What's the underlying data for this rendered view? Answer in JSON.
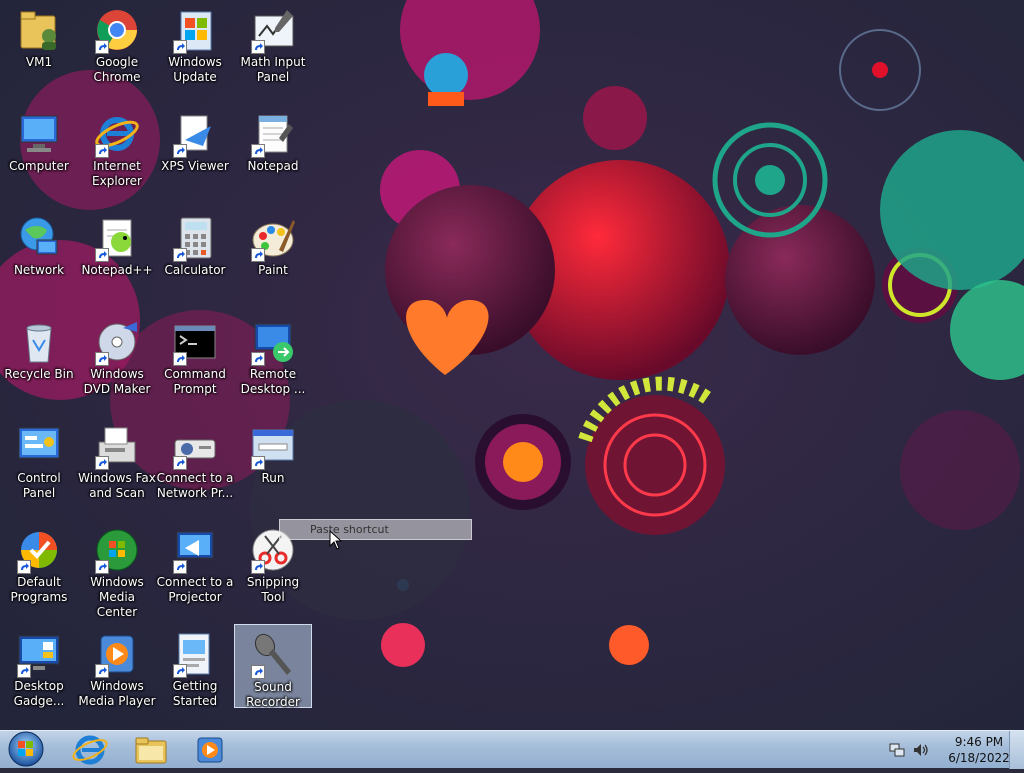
{
  "desktop": {
    "icons": [
      {
        "id": "vm1",
        "label": "VM1",
        "shortcut": false,
        "glyph": "folder-user-icon"
      },
      {
        "id": "chrome",
        "label": "Google\nChrome",
        "shortcut": true,
        "glyph": "chrome-icon"
      },
      {
        "id": "winupdate",
        "label": "Windows\nUpdate",
        "shortcut": true,
        "glyph": "windows-update-icon"
      },
      {
        "id": "mathinput",
        "label": "Math Input\nPanel",
        "shortcut": true,
        "glyph": "math-input-icon"
      },
      {
        "id": "computer",
        "label": "Computer",
        "shortcut": false,
        "glyph": "computer-icon"
      },
      {
        "id": "ie",
        "label": "Internet\nExplorer",
        "shortcut": true,
        "glyph": "ie-icon"
      },
      {
        "id": "xps",
        "label": "XPS Viewer",
        "shortcut": true,
        "glyph": "xps-viewer-icon"
      },
      {
        "id": "notepad",
        "label": "Notepad",
        "shortcut": true,
        "glyph": "notepad-icon"
      },
      {
        "id": "network",
        "label": "Network",
        "shortcut": false,
        "glyph": "network-icon"
      },
      {
        "id": "notepadpp",
        "label": "Notepad++",
        "shortcut": true,
        "glyph": "notepad-plus-icon"
      },
      {
        "id": "calculator",
        "label": "Calculator",
        "shortcut": true,
        "glyph": "calculator-icon"
      },
      {
        "id": "paint",
        "label": "Paint",
        "shortcut": true,
        "glyph": "paint-icon"
      },
      {
        "id": "recycle",
        "label": "Recycle Bin",
        "shortcut": false,
        "glyph": "recycle-bin-icon"
      },
      {
        "id": "dvdmaker",
        "label": "Windows\nDVD Maker",
        "shortcut": true,
        "glyph": "dvd-maker-icon"
      },
      {
        "id": "cmd",
        "label": "Command\nPrompt",
        "shortcut": true,
        "glyph": "command-prompt-icon"
      },
      {
        "id": "rdp",
        "label": "Remote\nDesktop ...",
        "shortcut": true,
        "glyph": "remote-desktop-icon"
      },
      {
        "id": "controlpanel",
        "label": "Control Panel",
        "shortcut": false,
        "glyph": "control-panel-icon"
      },
      {
        "id": "faxscan",
        "label": "Windows Fax\nand Scan",
        "shortcut": true,
        "glyph": "fax-scan-icon"
      },
      {
        "id": "netprojector",
        "label": "Connect to a\nNetwork Pr...",
        "shortcut": true,
        "glyph": "network-projector-icon"
      },
      {
        "id": "run",
        "label": "Run",
        "shortcut": true,
        "glyph": "run-icon"
      },
      {
        "id": "defaultprog",
        "label": "Default\nPrograms",
        "shortcut": true,
        "glyph": "default-programs-icon"
      },
      {
        "id": "mediacenter",
        "label": "Windows\nMedia Center",
        "shortcut": true,
        "glyph": "media-center-icon"
      },
      {
        "id": "projector",
        "label": "Connect to a\nProjector",
        "shortcut": true,
        "glyph": "projector-icon"
      },
      {
        "id": "snipping",
        "label": "Snipping Tool",
        "shortcut": true,
        "glyph": "snipping-tool-icon"
      },
      {
        "id": "gadgets",
        "label": "Desktop\nGadge...",
        "shortcut": true,
        "glyph": "desktop-gadgets-icon"
      },
      {
        "id": "mediaplayer",
        "label": "Windows\nMedia Player",
        "shortcut": true,
        "glyph": "media-player-icon"
      },
      {
        "id": "gettingstarted",
        "label": "Getting\nStarted",
        "shortcut": true,
        "glyph": "getting-started-icon"
      },
      {
        "id": "soundrec",
        "label": "Sound\nRecorder",
        "shortcut": true,
        "glyph": "sound-recorder-icon",
        "selected": true
      }
    ]
  },
  "drag_tooltip": {
    "text": "Paste shortcut"
  },
  "taskbar": {
    "start_icon": "windows-start-orb-icon",
    "pinned": [
      {
        "name": "internet-explorer",
        "icon": "ie-icon"
      },
      {
        "name": "windows-explorer",
        "icon": "folder-explorer-icon"
      },
      {
        "name": "windows-media-player",
        "icon": "media-player-icon"
      }
    ],
    "tray": {
      "network_icon": "network-tray-icon",
      "volume_icon": "volume-icon",
      "time": "9:46 PM",
      "date": "6/18/2022"
    }
  },
  "colors": {
    "selection": "#bed2eb",
    "taskbar": "#a3bcd8",
    "accent_magenta": "#d0186a",
    "accent_teal": "#1fa58a"
  }
}
